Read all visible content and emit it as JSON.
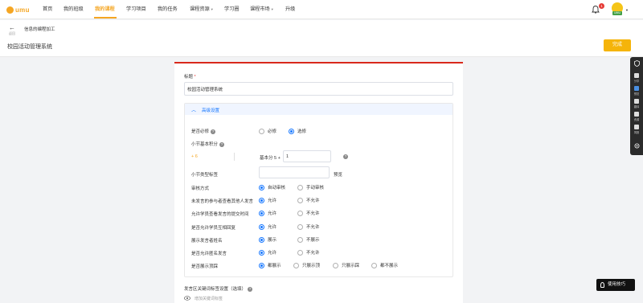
{
  "nav": {
    "logo_text": "umu",
    "items": [
      "首页",
      "我的班级",
      "我的课程",
      "学习项目",
      "我的任务",
      "课程资源",
      "学习圈",
      "课程市场",
      "升级"
    ],
    "notification_count": "1",
    "avatar_tag": "UMU"
  },
  "subheader": {
    "back_label": "返回",
    "course_sub": "信息的编程加工",
    "page_title": "校园活动管理系统",
    "done_label": "完成"
  },
  "form": {
    "title_label": "标题",
    "required_mark": "*",
    "title_value": "校园活动管理系统",
    "advanced_label": "高级设置",
    "required_field": {
      "label": "是否必修",
      "options": [
        "必修",
        "选修"
      ],
      "selected": 1
    },
    "base_score_label": "小节基本积分",
    "plus_score": "+ 6",
    "base_score_prefix": "基本分 5 +",
    "base_score_value": "1",
    "type_tag_label": "小节类型标签",
    "preview_label": "预览",
    "rows": [
      {
        "label": "审核方式",
        "options": [
          "自动审核",
          "手动审核"
        ],
        "selected": 0
      },
      {
        "label": "未发言的参与者查看其他人发言",
        "options": [
          "允许",
          "不允许"
        ],
        "selected": 0
      },
      {
        "label": "允许学员查看发言的提交时间",
        "options": [
          "允许",
          "不允许"
        ],
        "selected": 0
      },
      {
        "label": "是否允许学员互相回复",
        "options": [
          "允许",
          "不允许"
        ],
        "selected": 0
      },
      {
        "label": "展示发言者姓名",
        "options": [
          "展示",
          "不展示"
        ],
        "selected": 0
      },
      {
        "label": "是否允许匿名发言",
        "options": [
          "允许",
          "不允许"
        ],
        "selected": 0
      },
      {
        "label": "是否展示顶踩",
        "options": [
          "都展示",
          "只展示顶",
          "只展示踩",
          "都不展示"
        ],
        "selected": 0
      }
    ],
    "keyword_label": "发言区关键词标签设置（选填）",
    "keyword_hint": "增加关键词标签"
  },
  "rightbar": {
    "items": [
      "分享",
      "预览",
      "翻译",
      "资源",
      "简报"
    ]
  },
  "tips_label": "使用技巧",
  "colors": {
    "accent": "#f5a623",
    "primary": "#1677ff",
    "red_top": "#d9291c"
  }
}
